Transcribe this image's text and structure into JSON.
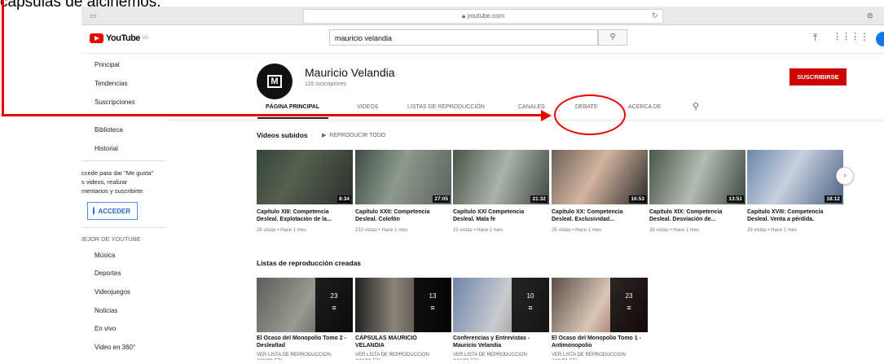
{
  "caption": "capsulas de alcinemos.",
  "browser": {
    "url": "youtube.com"
  },
  "header": {
    "logo_text": "YouTube",
    "logo_region": "CO",
    "search_value": "mauricio velandia"
  },
  "sidebar": {
    "top_items": [
      "Principal",
      "Tendencias",
      "Suscripciones"
    ],
    "library_items": [
      "Biblioteca",
      "Historial"
    ],
    "signin_lines": [
      "ccede para dar \"Me gusta\"",
      "s videos, realizar",
      "mentarios y suscribirte."
    ],
    "signin_button": "ACCEDER",
    "best_heading": "IEJOR DE YOUTUBE",
    "best_items": [
      "Música",
      "Deportes",
      "Videojuegos",
      "Noticias",
      "En vivo",
      "Video en 360°"
    ]
  },
  "channel": {
    "name": "Mauricio Velandia",
    "subscribers": "116 suscriptores",
    "subscribe_label": "SUSCRIBIRSE",
    "avatar_letter": "M"
  },
  "tabs": [
    "PÁGINA PRINCIPAL",
    "VIDEOS",
    "LISTAS DE REPRODUCCIÓN",
    "CANALES",
    "DEBATE",
    "ACERCA DE"
  ],
  "uploads": {
    "title": "Videos subidos",
    "play_all": "REPRODUCIR TODO",
    "videos": [
      {
        "title1": "Capítulo XIII: Competencia",
        "title2": "Desleal. Explotación de la...",
        "meta": "28 vistas • Hace 1 mes",
        "duration": "8:34"
      },
      {
        "title1": "Capítulo XXII: Competencia",
        "title2": "Desleal. Colofón",
        "meta": "132 vistas • Hace 1 mes",
        "duration": "27:05"
      },
      {
        "title1": "Capítulo XXI Competencia",
        "title2": "Desleal. Mala fe",
        "meta": "22 vistas • Hace 1 mes",
        "duration": "21:32"
      },
      {
        "title1": "Capítulo XX: Competencia",
        "title2": "Desleal. Exclusividad...",
        "meta": "25 vistas • Hace 1 mes",
        "duration": "16:53"
      },
      {
        "title1": "Capítulo XIX: Competencia",
        "title2": "Desleal. Desviación de...",
        "meta": "38 vistas • Hace 1 mes",
        "duration": "13:51"
      },
      {
        "title1": "Capítulo XVIII: Competencia",
        "title2": "Desleal. Venta a pérdida.",
        "meta": "39 vistas • Hace 1 mes",
        "duration": "18:12"
      }
    ]
  },
  "playlists": {
    "title": "Listas de reproducción creadas",
    "items": [
      {
        "title1": "El Ocaso del Monopolio Tomo 2 -",
        "title2": "Deslealtad",
        "count": "23",
        "link": "VER LISTA DE REPRODUCCIÓN COMPLETA"
      },
      {
        "title1": "CÁPSULAS MAURICIO",
        "title2": "VELANDIA",
        "count": "13",
        "link": "VER LISTA DE REPRODUCCIÓN COMPLETA"
      },
      {
        "title1": "Conferencias y Entrevistas -",
        "title2": "Mauricio Velandia",
        "count": "10",
        "link": "VER LISTA DE REPRODUCCIÓN COMPLETA"
      },
      {
        "title1": "El Ocaso del Monopolio Tomo 1 -",
        "title2": "Antimonopolio",
        "count": "23",
        "link": "VER LISTA DE REPRODUCCIÓN COMPLETA"
      }
    ]
  },
  "colors": {
    "accent_red": "#cc0000",
    "annotation_red": "#ee0000",
    "link_blue": "#2065d1"
  }
}
